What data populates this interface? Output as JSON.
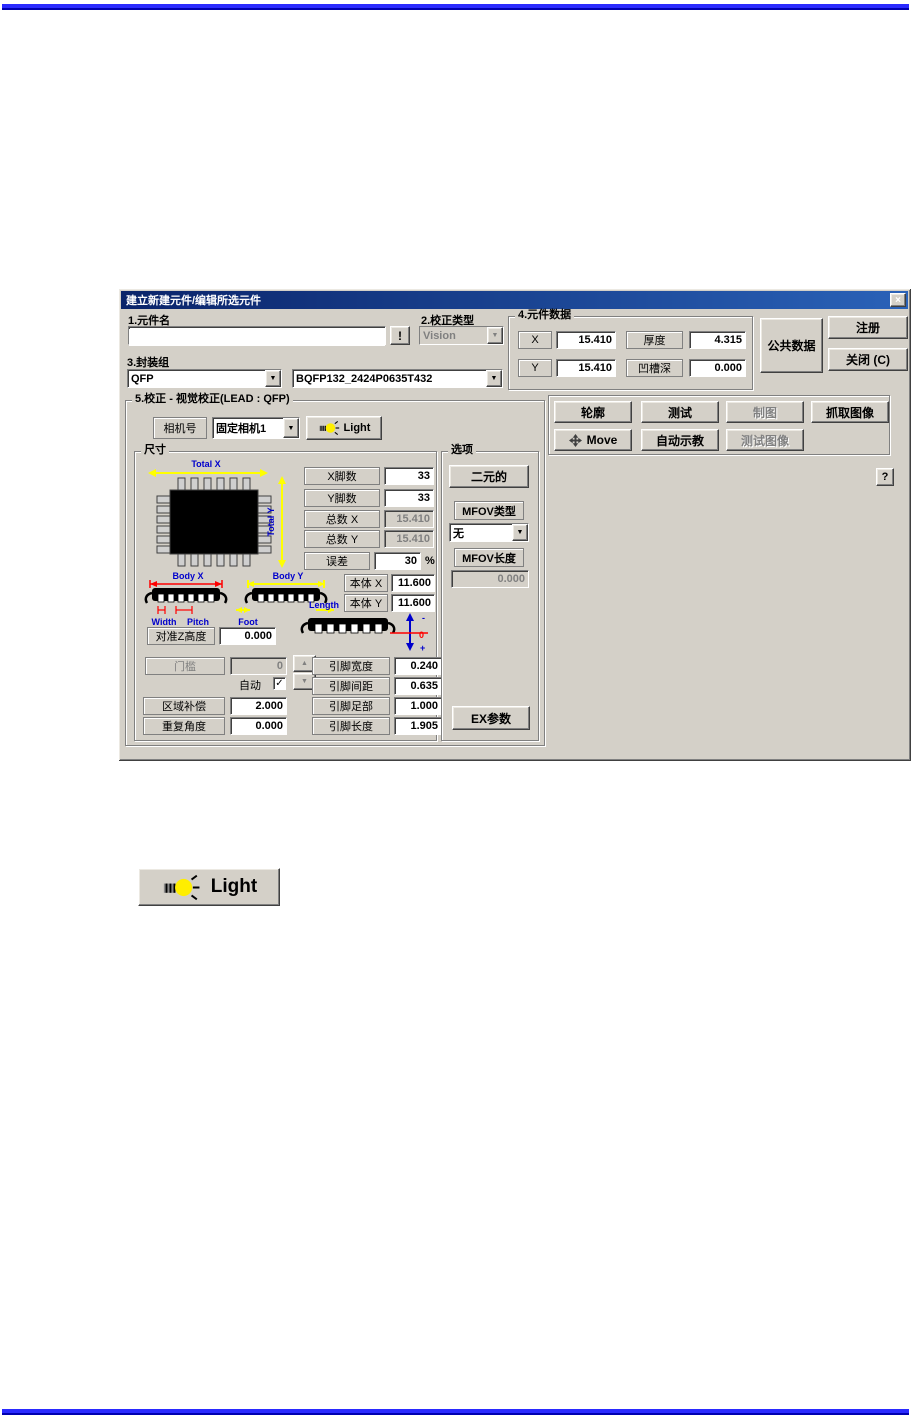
{
  "page": {
    "rule_color_bright": "#2a2aff",
    "rule_color_dark": "#0000b0"
  },
  "icons": {
    "close": "×",
    "dropdown": "▼",
    "spin_up": "▲",
    "spin_down": "▼",
    "check": "✓"
  },
  "colors": {
    "dialog_bg": "#d4d0c8",
    "titlebar_from": "#0a246a",
    "titlebar_to": "#2a62b8",
    "dim_yellow": "#ffff00",
    "dim_red": "#ff0000",
    "label_blue": "#0000cc"
  },
  "dialog": {
    "title": "建立新建元件/编辑所选元件",
    "part_name": {
      "label": "1.元件名",
      "value": "",
      "alert_btn": "!"
    },
    "cal_type": {
      "label": "2.校正类型",
      "value": "Vision"
    },
    "package_group": {
      "label": "3.封装组",
      "group": "QFP",
      "package": "BQFP132_2424P0635T432"
    },
    "part_data": {
      "label": "4.元件数据",
      "x_label": "X",
      "x_value": "15.410",
      "thickness_label": "厚度",
      "thickness_value": "4.315",
      "y_label": "Y",
      "y_value": "15.410",
      "groove_label": "凹槽深",
      "groove_value": "0.000"
    },
    "common_data_btn": "公共数据",
    "register_btn": "注册",
    "close_btn": "关闭 (C)",
    "calibration": {
      "label": "5.校正 - 视觉校正(LEAD : QFP)",
      "camera_label": "相机号",
      "camera_value": "固定相机1",
      "light_btn": "Light"
    },
    "actions": {
      "outline": "轮廓",
      "test": "测试",
      "plot": "制图",
      "grab_image": "抓取图像",
      "move": "Move",
      "auto_teach": "自动示教",
      "test_image": "测试图像",
      "help": "?"
    },
    "size": {
      "label": "尺寸",
      "x_pins_label": "X脚数",
      "x_pins_value": "33",
      "y_pins_label": "Y脚数",
      "y_pins_value": "33",
      "total_x_label": "总数 X",
      "total_x_value": "15.410",
      "total_y_label": "总数 Y",
      "total_y_value": "15.410",
      "tolerance_label": "误差",
      "tolerance_value": "30",
      "tolerance_unit": "%",
      "body_x_label": "本体 X",
      "body_x_value": "11.600",
      "body_y_label": "本体 Y",
      "body_y_value": "11.600",
      "align_z_label": "对准Z高度",
      "align_z_value": "0.000",
      "threshold_label": "门槛",
      "threshold_value": "0",
      "auto_label": "自动",
      "area_comp_label": "区域补偿",
      "area_comp_value": "2.000",
      "repeat_angle_label": "重复角度",
      "repeat_angle_value": "0.000",
      "lead_width_label": "引脚宽度",
      "lead_width_value": "0.240",
      "lead_pitch_label": "引脚间距",
      "lead_pitch_value": "0.635",
      "lead_foot_label": "引脚足部",
      "lead_foot_value": "1.000",
      "lead_length_label": "引脚长度",
      "lead_length_value": "1.905"
    },
    "options": {
      "label": "选项",
      "binary_btn": "二元的",
      "mfov_type_label": "MFOV类型",
      "mfov_type_value": "无",
      "mfov_length_label": "MFOV长度",
      "mfov_length_value": "0.000",
      "ex_btn": "EX参数"
    },
    "diagram": {
      "total_x": "Total X",
      "total_y": "Total Y",
      "body_x": "Body X",
      "body_y": "Body Y",
      "width": "Width",
      "pitch": "Pitch",
      "foot": "Foot",
      "length": "Length",
      "axis_minus": "-",
      "axis_zero": "0",
      "axis_plus": "+"
    }
  },
  "light_image": {
    "label": "Light"
  }
}
